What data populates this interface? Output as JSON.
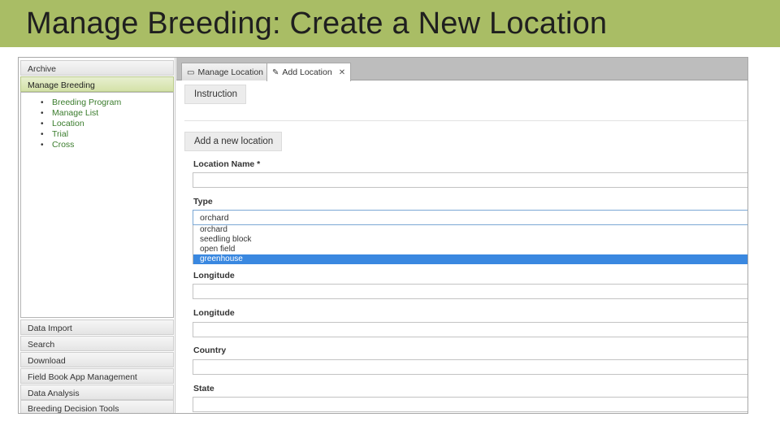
{
  "slide": {
    "title": "Manage Breeding: Create a New Location"
  },
  "sidebar": {
    "headers_top": [
      {
        "label": "Archive"
      },
      {
        "label": "Manage Breeding"
      }
    ],
    "menu_items": [
      {
        "label": "Breeding Program"
      },
      {
        "label": "Manage List"
      },
      {
        "label": "Location"
      },
      {
        "label": "Trial"
      },
      {
        "label": "Cross"
      }
    ],
    "headers_bottom": [
      {
        "label": "Data Import"
      },
      {
        "label": "Search"
      },
      {
        "label": "Download"
      },
      {
        "label": "Field Book App Management"
      },
      {
        "label": "Data Analysis"
      },
      {
        "label": "Breeding Decision Tools"
      }
    ]
  },
  "tabs": [
    {
      "label": "Manage Location",
      "icon": "window-icon"
    },
    {
      "label": "Add Location",
      "icon": "pencil-icon",
      "close": "✕"
    }
  ],
  "main": {
    "instruction_label": "Instruction",
    "add_new_label": "Add a new location",
    "location_name_label": "Location Name *",
    "type_label": "Type",
    "type_selected": "orchard",
    "type_options": [
      "orchard",
      "seedling block",
      "open field",
      "greenhouse"
    ],
    "type_highlighted_index": 3,
    "longitude_label_1": "Longitude",
    "longitude_label_2": "Longitude",
    "country_label": "Country",
    "state_label": "State"
  },
  "colors": {
    "title_bar": "#a9bd65",
    "link_green": "#3a7c2c",
    "selection_blue": "#3a88e0"
  }
}
